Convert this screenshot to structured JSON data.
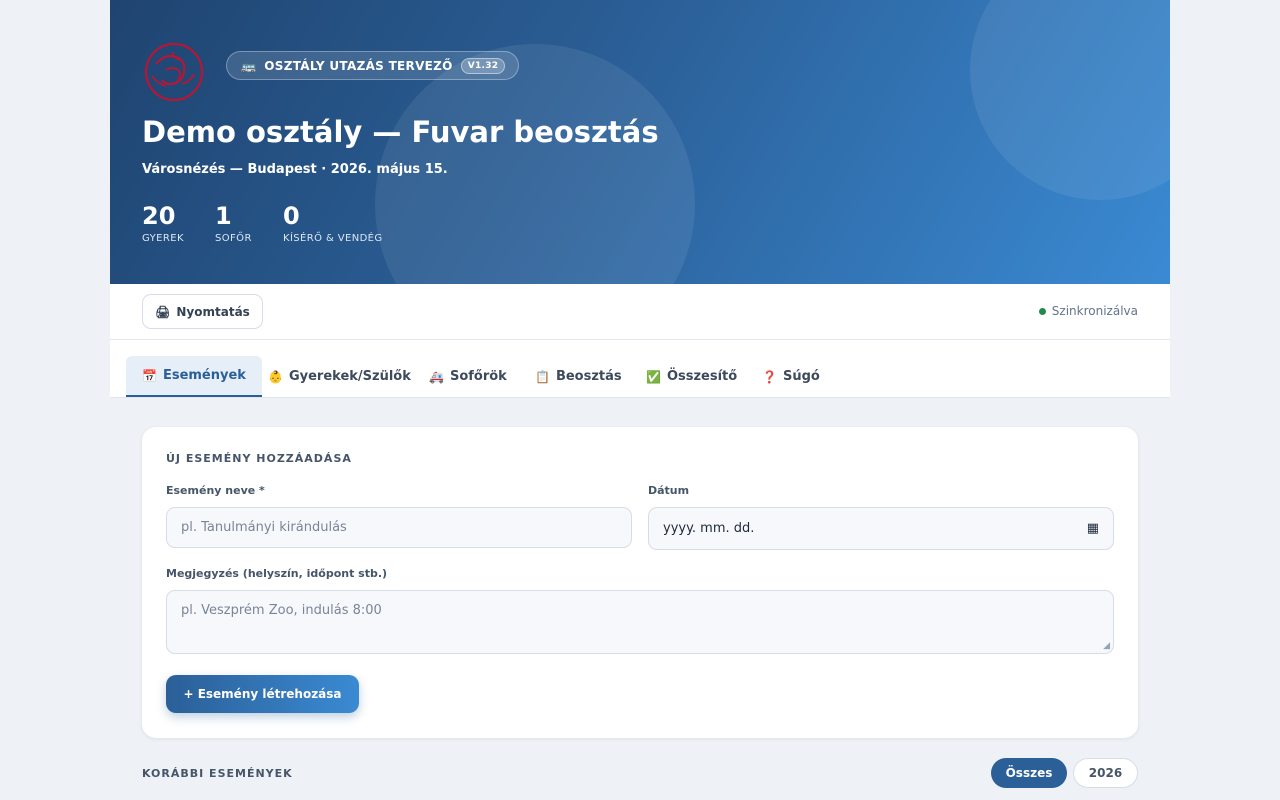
{
  "header": {
    "app_name": "OSZTÁLY UTAZÁS TERVEZŐ",
    "version": "V1.32",
    "title": "Demo osztály — Fuvar beosztás",
    "subtitle": "Városnézés — Budapest · 2026. május 15.",
    "stats": [
      {
        "value": "20",
        "label": "GYEREK"
      },
      {
        "value": "1",
        "label": "SOFŐR"
      },
      {
        "value": "0",
        "label": "KÍSÉRŐ & VENDÉG"
      }
    ]
  },
  "toolbar": {
    "print_label": "Nyomtatás",
    "sync_status": "Szinkronizálva"
  },
  "tabs": [
    {
      "icon": "📅",
      "label": "Események",
      "active": true
    },
    {
      "icon": "👶",
      "label": "Gyerekek/Szülők"
    },
    {
      "icon": "🚑",
      "label": "Sofőrök"
    },
    {
      "icon": "📋",
      "label": "Beosztás"
    },
    {
      "icon": "✅",
      "label": "Összesítő"
    },
    {
      "icon": "❓",
      "label": "Súgó"
    }
  ],
  "form": {
    "section_title": "ÚJ ESEMÉNY HOZZÁADÁSA",
    "name_label": "Esemény neve *",
    "name_placeholder": "pl. Tanulmányi kirándulás",
    "date_label": "Dátum",
    "date_placeholder": "yyyy. mm. dd.",
    "note_label": "Megjegyzés (helyszín, időpont stb.)",
    "note_placeholder": "pl. Veszprém Zoo, indulás 8:00",
    "create_label": "+ Esemény létrehozása"
  },
  "previous": {
    "title": "KORÁBBI ESEMÉNYEK",
    "filters": [
      "Összes",
      "2026"
    ]
  },
  "colors": {
    "primary": "#2b5f97",
    "accent": "#3a8ad3",
    "sync_ok": "#1f8a4c",
    "logo_red": "#c8102e"
  }
}
